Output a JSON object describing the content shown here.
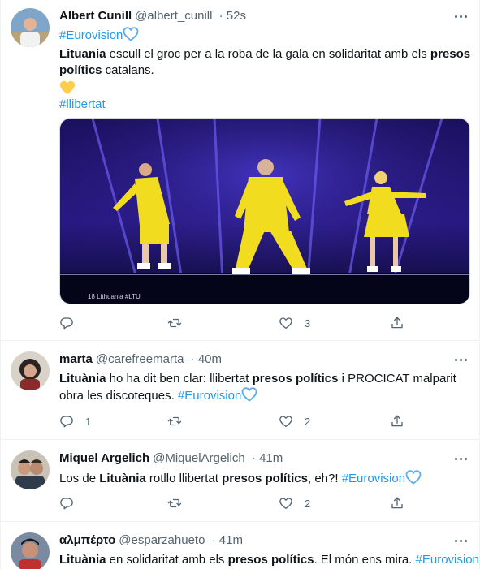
{
  "tweets": [
    {
      "name": "Albert Cunill",
      "handle": "@albert_cunill",
      "dot": "·",
      "time": "52s",
      "hashtag_top": "#Eurovision",
      "text_b1": "Lituania",
      "text_1": " escull el groc per a la roba de la gala en solidaritat amb els ",
      "text_b2": "presos polítics",
      "text_2": " catalans.",
      "hashtag_bottom": "#llibertat",
      "media_caption": "18 Lithuania #LTU",
      "replies": "",
      "retweets": "",
      "likes": "3"
    },
    {
      "name": "marta",
      "handle": "@carefreemarta",
      "dot": "·",
      "time": "40m",
      "text_b1": "Lituània",
      "text_1": " ho ha dit ben clar: llibertat ",
      "text_b2": "presos polítics",
      "text_2": " i PROCICAT malparit obra les discoteques. ",
      "hashtag": "#Eurovision",
      "replies": "1",
      "retweets": "",
      "likes": "2"
    },
    {
      "name": "Miquel Argelich",
      "handle": "@MiquelArgelich",
      "dot": "·",
      "time": "41m",
      "text_0": "Los de ",
      "text_b1": "Lituània",
      "text_1": " rotllo llibertat ",
      "text_b2": "presos polítics",
      "text_2": ", eh?! ",
      "hashtag": "#Eurovision",
      "replies": "",
      "retweets": "",
      "likes": "2"
    },
    {
      "name": "αλμπέρτο",
      "handle": "@esparzahueto",
      "dot": "·",
      "time": "41m",
      "text_b1": "Lituània",
      "text_1": " en solidaritat amb els ",
      "text_b2": "presos polítics",
      "text_2": ". El món ens mira. ",
      "hashtag": "#Eurovision"
    }
  ],
  "colors": {
    "accent": "#1d9bf0",
    "text": "#0f1419",
    "muted": "#536471",
    "yellow_heart": "#ffcc4d",
    "blue_heart": "#5dadec"
  },
  "icons": [
    "reply-icon",
    "retweet-icon",
    "like-icon",
    "share-icon",
    "more-icon",
    "yellow-heart-icon",
    "blue-heart-icon"
  ]
}
